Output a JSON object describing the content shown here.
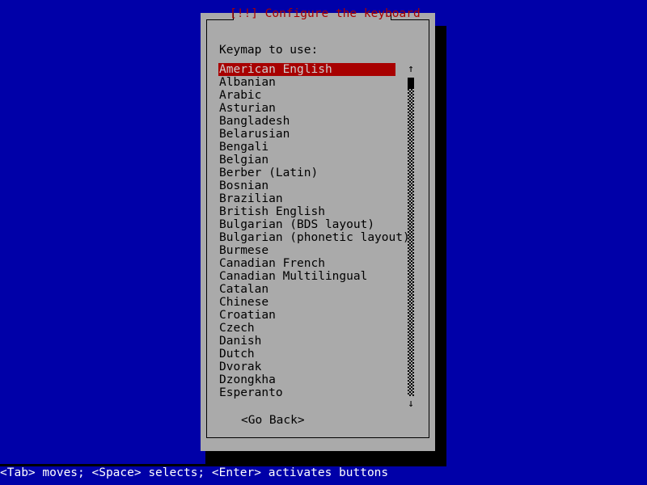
{
  "screen": {
    "background_color": "#0000a8"
  },
  "dialog": {
    "title": "[!!] Configure the keyboard",
    "title_color": "#a80000",
    "panel_color": "#aaaaaa",
    "prompt": "Keymap to use:",
    "selected_index": 0,
    "highlight_color": "#a80000",
    "highlight_text_color": "#cfcfcf",
    "items": [
      "American English",
      "Albanian",
      "Arabic",
      "Asturian",
      "Bangladesh",
      "Belarusian",
      "Bengali",
      "Belgian",
      "Berber (Latin)",
      "Bosnian",
      "Brazilian",
      "British English",
      "Bulgarian (BDS layout)",
      "Bulgarian (phonetic layout)",
      "Burmese",
      "Canadian French",
      "Canadian Multilingual",
      "Catalan",
      "Chinese",
      "Croatian",
      "Czech",
      "Danish",
      "Dutch",
      "Dvorak",
      "Dzongkha",
      "Esperanto"
    ],
    "scrollbar": {
      "up_arrow": "↑",
      "down_arrow": "↓"
    },
    "go_back_label": "<Go Back>"
  },
  "status_bar": {
    "text": "<Tab> moves; <Space> selects; <Enter> activates buttons",
    "background_color": "#0000a8",
    "text_color": "#ffffff"
  }
}
